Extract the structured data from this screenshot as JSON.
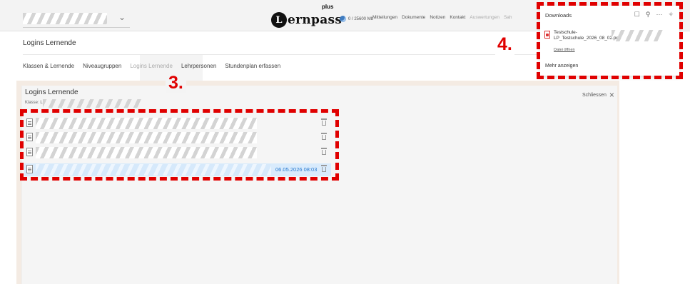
{
  "topbar": {
    "school_select_chevron": "⌄",
    "logo_initial": "L",
    "logo_text": "ernpass",
    "logo_plus": "plus",
    "storage": "0 / 25600 Mb",
    "nav": [
      "Mitteilungen",
      "Dokumente",
      "Notizen",
      "Kontakt",
      "Auswertungen",
      "Sah"
    ]
  },
  "page_title": "Logins Lernende",
  "tabs": [
    {
      "label": "Klassen & Lernende",
      "active": false
    },
    {
      "label": "Niveaugruppen",
      "active": false
    },
    {
      "label": "Logins Lernende",
      "active": true
    },
    {
      "label": "Lehrpersonen",
      "active": false
    },
    {
      "label": "Stundenplan erfassen",
      "active": false
    }
  ],
  "panel": {
    "title": "Logins Lernende",
    "klasse_label": "Klasse: L",
    "close_label": "Schliessen",
    "close_icon": "×"
  },
  "files": [
    {
      "date": ""
    },
    {
      "date": ""
    },
    {
      "date": ""
    },
    {
      "date": "06.05.2026 08:03"
    }
  ],
  "annotations": {
    "label3": "3.",
    "label4": "4."
  },
  "downloads": {
    "title": "Downloads",
    "file_name": "Testschule-LP_Testschule_2026_08_02.pdf",
    "open_link": "Datei öffnen",
    "more": "Mehr anzeigen",
    "icons": [
      "folder-icon",
      "search-icon",
      "more-icon",
      "pin-icon"
    ],
    "icon_glyphs": [
      "☐",
      "⚲",
      "···",
      "✧"
    ]
  },
  "colors": {
    "annotation_red": "#e00000",
    "panel_bg": "#f4ebe3",
    "selected_row": "#d9ebfc",
    "date_blue": "#2b7bd0"
  }
}
